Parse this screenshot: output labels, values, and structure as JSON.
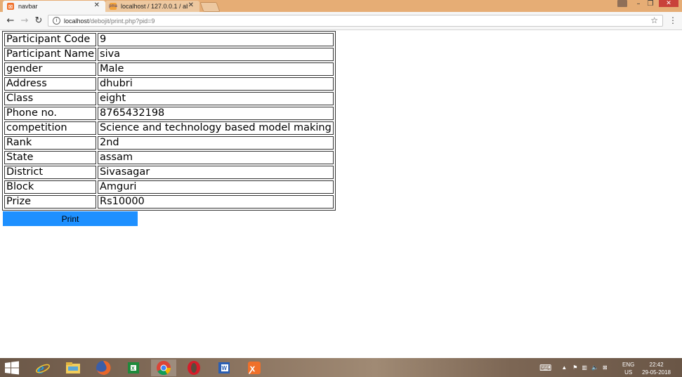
{
  "browser": {
    "tabs": [
      {
        "title": "navbar",
        "active": true
      },
      {
        "title": "localhost / 127.0.0.1 / ab",
        "active": false
      }
    ],
    "url_host": "localhost",
    "url_path": "/debojit/print.php?pid=9",
    "colors": {
      "titlebar": "#e6ad75",
      "close_button": "#c9413a"
    }
  },
  "participant": {
    "rows": [
      {
        "label": "Participant Code",
        "value": "9"
      },
      {
        "label": "Participant Name",
        "value": "siva"
      },
      {
        "label": "gender",
        "value": "Male"
      },
      {
        "label": "Address",
        "value": "dhubri"
      },
      {
        "label": "Class",
        "value": "eight"
      },
      {
        "label": "Phone no.",
        "value": "8765432198"
      },
      {
        "label": "competition",
        "value": "Science and technology based model making"
      },
      {
        "label": "Rank",
        "value": "2nd"
      },
      {
        "label": "State",
        "value": "assam"
      },
      {
        "label": "District",
        "value": "Sivasagar"
      },
      {
        "label": "Block",
        "value": "Amguri"
      },
      {
        "label": "Prize",
        "value": "Rs10000"
      }
    ],
    "print_label": "Print",
    "print_color": "#1e90ff"
  },
  "taskbar": {
    "apps": [
      "start-icon",
      "ie-icon",
      "file-explorer-icon",
      "firefox-icon",
      "excel-icon",
      "chrome-icon",
      "opera-icon",
      "word-icon",
      "xampp-icon"
    ],
    "active_app": "chrome-icon",
    "lang_top": "ENG",
    "lang_bottom": "US",
    "time": "22:42",
    "date": "29-05-2018"
  }
}
